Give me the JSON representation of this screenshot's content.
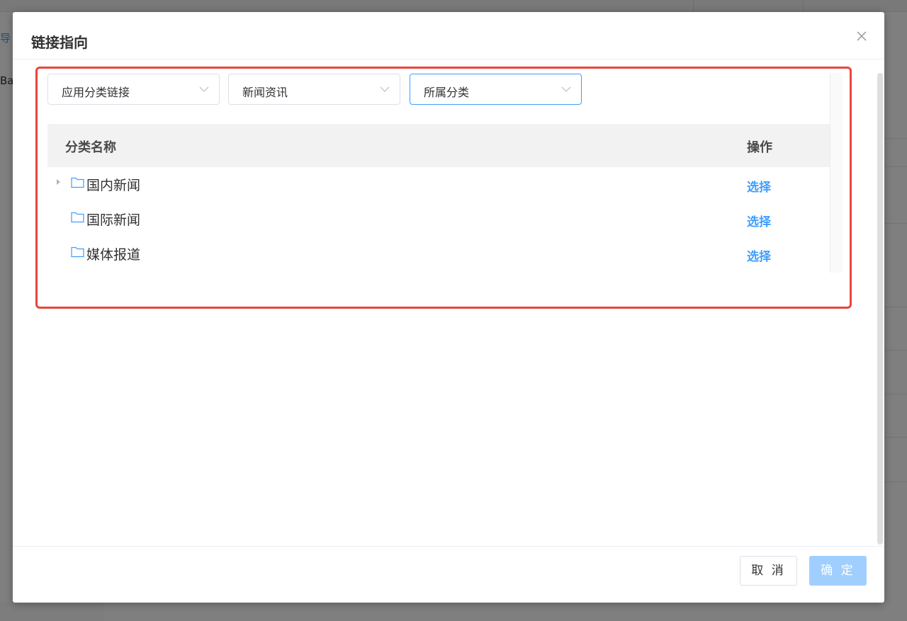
{
  "background": {
    "fragments": [
      "导",
      "Ba"
    ]
  },
  "dialog": {
    "title": "链接指向",
    "close_icon": "close-icon"
  },
  "filters": {
    "select1": {
      "value": "应用分类链接"
    },
    "select2": {
      "value": "新闻资讯"
    },
    "select3": {
      "value": "所属分类",
      "active": true
    }
  },
  "table": {
    "headers": {
      "name": "分类名称",
      "action": "操作"
    },
    "rows": [
      {
        "name": "国内新闻",
        "action": "选择",
        "expandable": true
      },
      {
        "name": "国际新闻",
        "action": "选择",
        "expandable": false
      },
      {
        "name": "媒体报道",
        "action": "选择",
        "expandable": false
      }
    ]
  },
  "footer": {
    "cancel_label": "取 消",
    "confirm_label": "确 定"
  },
  "colors": {
    "primary": "#409eff",
    "highlight_border": "#e8463a",
    "confirm_disabled": "#a0cfff"
  }
}
